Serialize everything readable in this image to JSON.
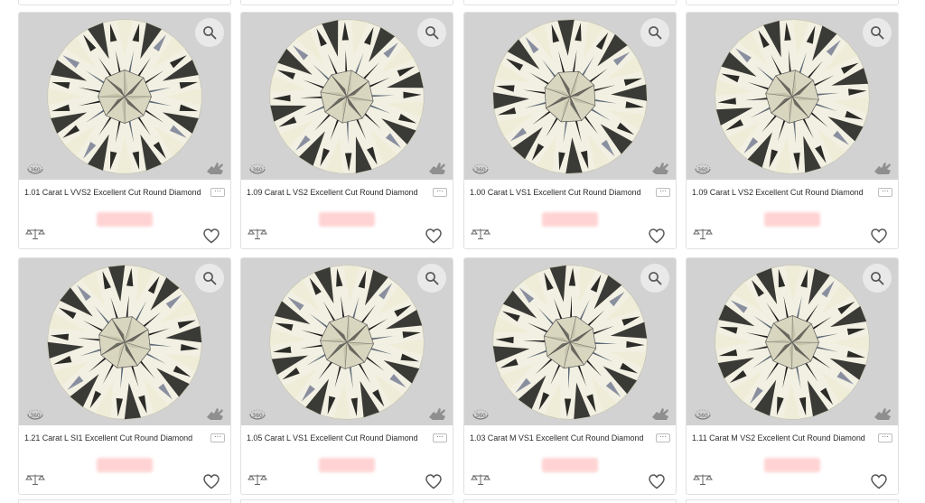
{
  "listing": {
    "price_label": "",
    "cards": [
      {
        "title": "1.01 Carat L VVS2 Excellent Cut Round Diamond",
        "more": "···"
      },
      {
        "title": "1.09 Carat L VS2 Excellent Cut Round Diamond",
        "more": "···"
      },
      {
        "title": "1.00 Carat L VS1 Excellent Cut Round Diamond",
        "more": "···"
      },
      {
        "title": "1.09 Carat L VS2 Excellent Cut Round Diamond",
        "more": "···"
      },
      {
        "title": "1.21 Carat L SI1 Excellent Cut Round Diamond",
        "more": "···"
      },
      {
        "title": "1.05 Carat L VS1 Excellent Cut Round Diamond",
        "more": "···"
      },
      {
        "title": "1.03 Carat M VS1 Excellent Cut Round Diamond",
        "more": "···"
      },
      {
        "title": "1.11 Carat M VS2 Excellent Cut Round Diamond",
        "more": "···"
      }
    ]
  },
  "icons": {
    "zoom": "magnifier-icon",
    "view360": "360-view-icon",
    "hand": "hand-icon",
    "compare": "compare-icon",
    "wishlist": "heart-icon"
  },
  "colors": {
    "media_bg": "#d2d2d2",
    "price_blur": "#ffd3d3",
    "card_border": "#e1e1e1"
  }
}
